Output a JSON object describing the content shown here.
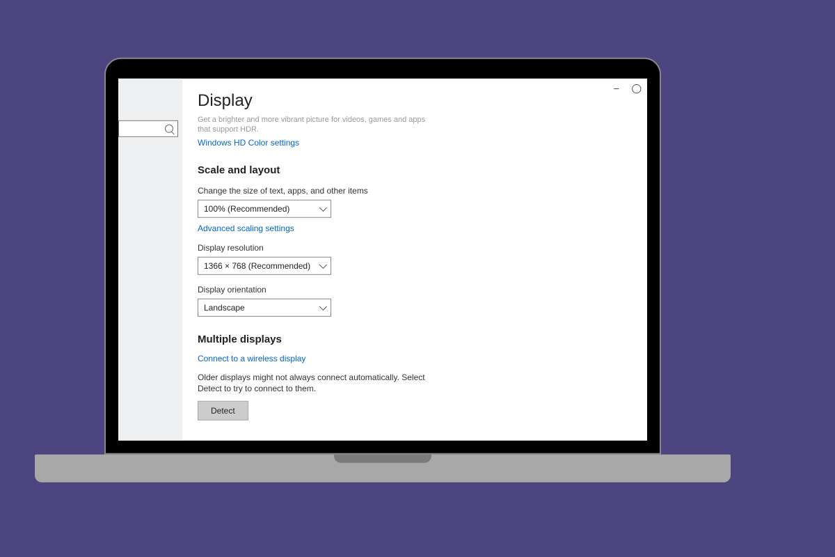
{
  "window": {
    "minimize": "–",
    "maximize": "◯"
  },
  "page": {
    "title": "Display",
    "hdr_desc": "Get a brighter and more vibrant picture for videos, games and apps that support HDR.",
    "hdr_link": "Windows HD Color settings"
  },
  "scale": {
    "heading": "Scale and layout",
    "size_label": "Change the size of text, apps, and other items",
    "size_value": "100% (Recommended)",
    "advanced_link": "Advanced scaling settings",
    "resolution_label": "Display resolution",
    "resolution_value": "1366 × 768 (Recommended)",
    "orientation_label": "Display orientation",
    "orientation_value": "Landscape"
  },
  "multi": {
    "heading": "Multiple displays",
    "wireless_link": "Connect to a wireless display",
    "info": "Older displays might not always connect automatically. Select Detect to try to connect to them.",
    "detect_label": "Detect"
  }
}
